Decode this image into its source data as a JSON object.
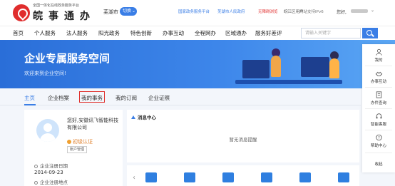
{
  "header": {
    "logo_sub": "全国一体化在线政务服务平台",
    "logo_main": "皖事通办",
    "city": "芜湖市",
    "switch_label": "切换",
    "links": [
      "国家政务服务平台",
      "芜湖市人民政府",
      "无障碍浏览",
      "皖江区用户",
      "网站支持IPv6"
    ],
    "greeting": "您好,"
  },
  "nav": {
    "items": [
      "首页",
      "个人服务",
      "法人服务",
      "阳光政务",
      "特色创新",
      "办事互动",
      "全程网办",
      "区域通办",
      "服务好差评"
    ],
    "search_placeholder": "请输入关键字"
  },
  "banner": {
    "title": "企业专属服务空间",
    "subtitle": "欢迎来到企业空间!"
  },
  "right_sidebar": {
    "items": [
      "我的",
      "办事互动",
      "办件查询",
      "智能客服",
      "帮助中心",
      "收起"
    ]
  },
  "tabs": {
    "items": [
      "主页",
      "企业档案",
      "我的事务",
      "我的订阅",
      "企业证照"
    ],
    "active_index": 0
  },
  "profile": {
    "company_name": "您好,安徽讯飞智能科技有限公司",
    "verification": "初级认证",
    "account_button": "账户管理",
    "registration_label": "企业注册日期",
    "registration_date": "2014-09-23",
    "location_label": "企业注册地点"
  },
  "messages": {
    "title": "消息中心",
    "empty_text": "暂无消息提醒"
  },
  "services": {
    "icon_names": [
      "folder-icon",
      "folder-icon",
      "document-icon",
      "calendar-icon",
      "user-icon",
      "star-icon"
    ],
    "icon_colors": [
      "#2f7fe0",
      "#2f7fe0",
      "#2f7fe0",
      "#2f7fe0",
      "#2f7fe0",
      "#2f7fe0"
    ]
  }
}
